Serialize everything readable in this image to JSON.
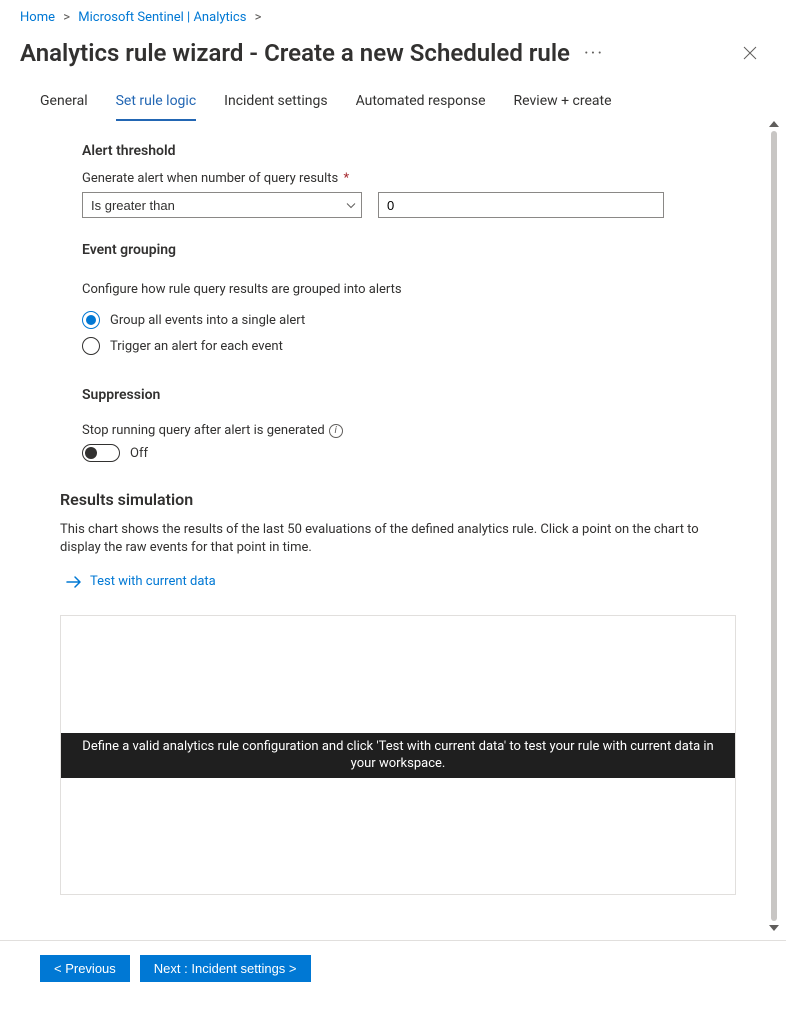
{
  "breadcrumb": {
    "home": "Home",
    "mid": "Microsoft Sentinel | Analytics",
    "sep": ">"
  },
  "title": "Analytics rule wizard - Create a new Scheduled rule",
  "ellipsis": "···",
  "tabs": {
    "general": "General",
    "set_rule_logic": "Set rule logic",
    "incident_settings": "Incident settings",
    "automated_response": "Automated response",
    "review_create": "Review + create"
  },
  "alert_threshold": {
    "heading": "Alert threshold",
    "label": "Generate alert when number of query results",
    "required_marker": "*",
    "operator_value": "Is greater than",
    "number_value": "0"
  },
  "event_grouping": {
    "heading": "Event grouping",
    "desc": "Configure how rule query results are grouped into alerts",
    "option1": "Group all events into a single alert",
    "option2": "Trigger an alert for each event",
    "selected": "option1"
  },
  "suppression": {
    "heading": "Suppression",
    "label": "Stop running query after alert is generated",
    "toggle_state": "Off",
    "info": "i"
  },
  "results": {
    "heading": "Results simulation",
    "desc": "This chart shows the results of the last 50 evaluations of the defined analytics rule. Click a point on the chart to display the raw events for that point in time.",
    "test_link": "Test with current data",
    "chart_message": "Define a valid analytics rule configuration and click 'Test with current data' to test your rule with current data in your workspace."
  },
  "footer": {
    "previous": "< Previous",
    "next": "Next : Incident settings >"
  }
}
